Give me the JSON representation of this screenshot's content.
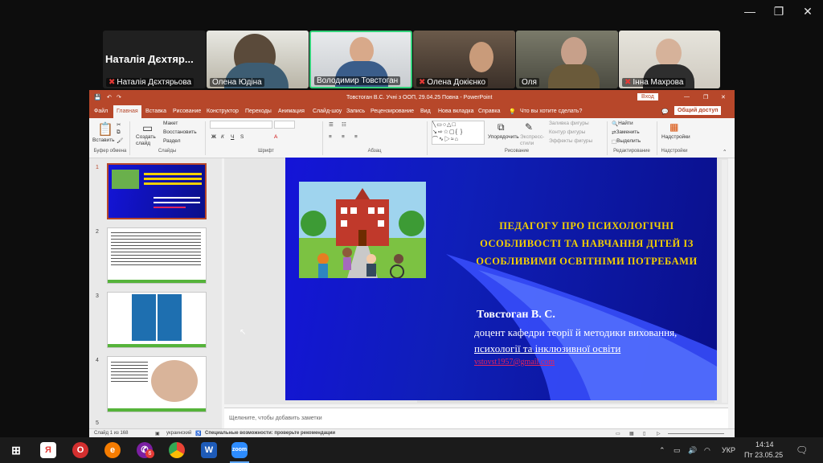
{
  "window_controls": {
    "minimize": "—",
    "restore": "❐",
    "close": "✕"
  },
  "participants": [
    {
      "name": "Наталія Дєхтярьова",
      "big_name": "Наталія Дєхтяр...",
      "muted": true
    },
    {
      "name": "Олена Юдіна",
      "muted": false
    },
    {
      "name": "Володимир Товстоган",
      "muted": false
    },
    {
      "name": "Олена Докієнко",
      "muted": true
    },
    {
      "name": "Оля",
      "muted": false
    },
    {
      "name": "Інна Махрова",
      "muted": true
    }
  ],
  "ppt": {
    "title": "Товстоган В.С. Учні з ООП, 29.04.25 Повна  -  PowerPoint",
    "login_button": "Вход",
    "share_button": "Общий доступ",
    "tabs": [
      "Файл",
      "Главная",
      "Вставка",
      "Рисование",
      "Конструктор",
      "Переходы",
      "Анимация",
      "Слайд-шоу",
      "Запись",
      "Рецензирование",
      "Вид",
      "Нова вкладка",
      "Справка"
    ],
    "tell_me": "Что вы хотите сделать?",
    "ribbon": {
      "paste": "Вставить",
      "new_slide": "Создать слайд",
      "layout": "Макет",
      "reset": "Восстановить",
      "section": "Раздел",
      "arrange": "Упорядочить",
      "express_styles": "Экспресс-стили",
      "shape_fill": "Заливка фигуры",
      "shape_outline": "Контур фигуры",
      "shape_effects": "Эффекты фигуры",
      "find": "Найти",
      "replace": "Заменить",
      "select": "Выделить",
      "addins": "Надстройки",
      "groups": [
        "Буфер обмена",
        "Слайды",
        "Шрифт",
        "Абзац",
        "Рисование",
        "Редактирование",
        "Надстройки"
      ]
    },
    "thumb_numbers": [
      "1",
      "2",
      "3",
      "4",
      "5"
    ],
    "notes_placeholder": "Щелкните, чтобы добавить заметки",
    "status": {
      "slide": "Слайд 1 из 168",
      "language": "украинский",
      "accessibility": "Специальные возможности: проверьте рекомендации"
    }
  },
  "slide": {
    "title_lines": [
      "ПЕДАГОГУ ПРО ПСИХОЛОГІЧНІ",
      "ОСОБЛИВОСТІ ТА НАВЧАННЯ ДІТЕЙ ІЗ",
      "ОСОБЛИВИМИ ОСВІТНІМИ ПОТРЕБАМИ"
    ],
    "author": "Товстоган В. С.",
    "role_lines": [
      "доцент кафедри теорії й методики виховання,",
      "психології та інклюзивної освіти"
    ],
    "email": "vstovst1957@gmail.com"
  },
  "taskbar": {
    "language": "УКР",
    "time": "14:14",
    "date": "Пт 23.05.25",
    "viber_badge": "6"
  },
  "colors": {
    "ppt_accent": "#b7472a",
    "slide_title": "#f4d000",
    "slide_bg": "#1414d8"
  }
}
